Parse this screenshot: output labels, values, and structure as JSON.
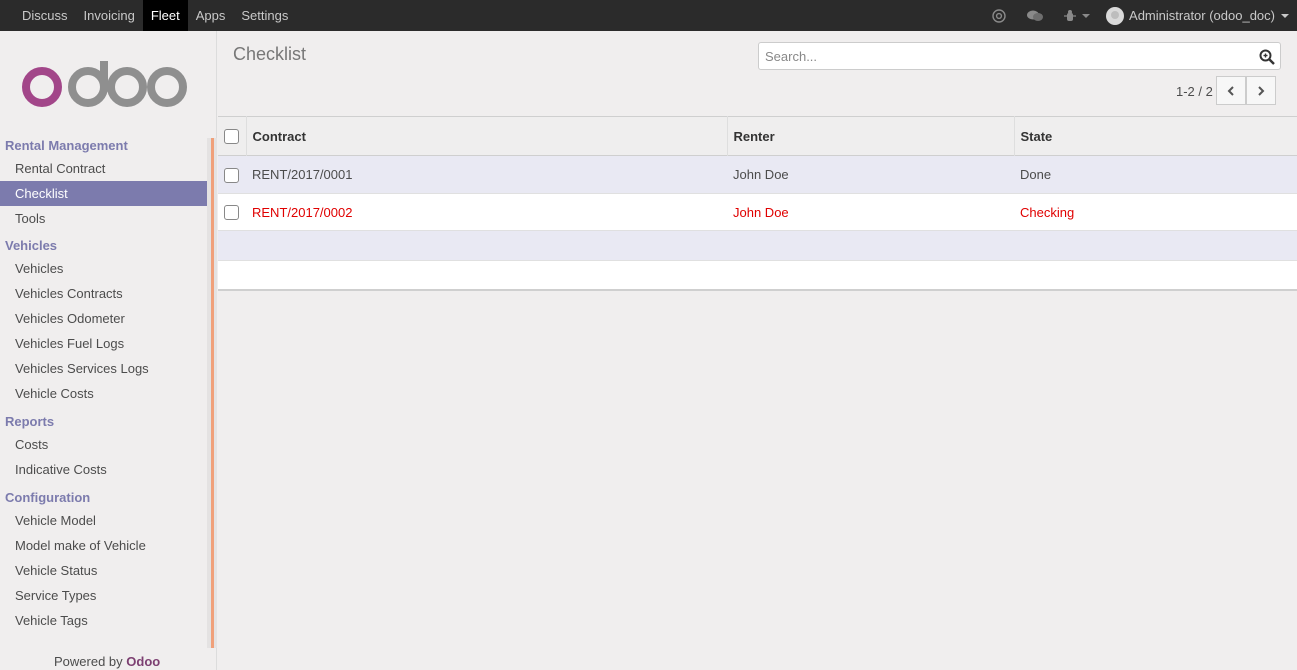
{
  "topbar": {
    "menus": [
      "Discuss",
      "Invoicing",
      "Fleet",
      "Apps",
      "Settings"
    ],
    "active": "Fleet",
    "user": "Administrator (odoo_doc)"
  },
  "logo_text": "odoo",
  "sidebar": {
    "sections": [
      {
        "title": "Rental Management",
        "items": [
          "Rental Contract",
          "Checklist",
          "Tools"
        ]
      },
      {
        "title": "Vehicles",
        "items": [
          "Vehicles",
          "Vehicles Contracts",
          "Vehicles Odometer",
          "Vehicles Fuel Logs",
          "Vehicles Services Logs",
          "Vehicle Costs"
        ]
      },
      {
        "title": "Reports",
        "items": [
          "Costs",
          "Indicative Costs"
        ]
      },
      {
        "title": "Configuration",
        "items": [
          "Vehicle Model",
          "Model make of Vehicle",
          "Vehicle Status",
          "Service Types",
          "Vehicle Tags"
        ]
      }
    ],
    "active_item": "Checklist",
    "powered_prefix": "Powered by",
    "powered_brand": "Odoo"
  },
  "control": {
    "title": "Checklist",
    "search_placeholder": "Search...",
    "pager": "1-2 / 2"
  },
  "list": {
    "columns": [
      "Contract",
      "Renter",
      "State"
    ],
    "rows": [
      {
        "contract": "RENT/2017/0001",
        "renter": "John Doe",
        "state": "Done"
      },
      {
        "contract": "RENT/2017/0002",
        "renter": "John Doe",
        "state": "Checking"
      }
    ]
  },
  "colors": {
    "brand": "#7c7bad",
    "topbar": "#2b2b2b",
    "highlight_red": "#e00000",
    "logo_purple": "#a24689",
    "logo_grey": "#8f8f8f"
  }
}
